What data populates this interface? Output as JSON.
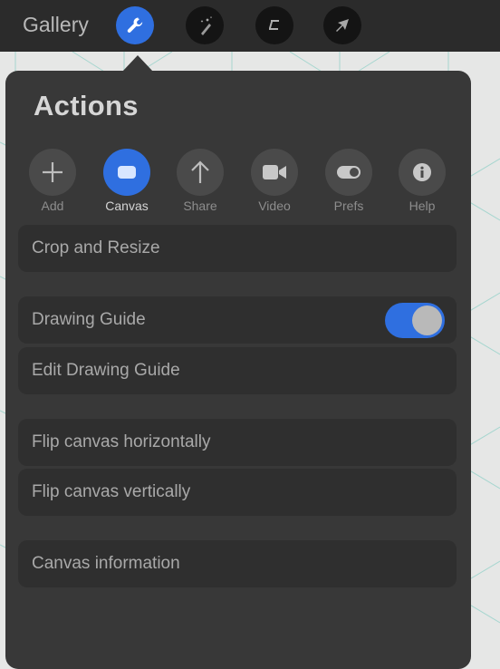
{
  "toolbar": {
    "gallery_label": "Gallery",
    "tools": [
      {
        "name": "actions",
        "icon": "wrench-icon",
        "active": true
      },
      {
        "name": "adjustments",
        "icon": "magic-wand-icon",
        "active": false
      },
      {
        "name": "selection",
        "icon": "selection-s-icon",
        "active": false
      },
      {
        "name": "transform",
        "icon": "arrow-cursor-icon",
        "active": false
      }
    ]
  },
  "panel": {
    "title": "Actions",
    "tabs": [
      {
        "label": "Add",
        "icon": "plus-icon",
        "active": false
      },
      {
        "label": "Canvas",
        "icon": "canvas-icon",
        "active": true
      },
      {
        "label": "Share",
        "icon": "share-arrow-icon",
        "active": false
      },
      {
        "label": "Video",
        "icon": "video-camera-icon",
        "active": false
      },
      {
        "label": "Prefs",
        "icon": "toggle-prefs-icon",
        "active": false
      },
      {
        "label": "Help",
        "icon": "info-icon",
        "active": false
      }
    ],
    "items": [
      {
        "label": "Crop and Resize"
      },
      {
        "label": "Drawing Guide",
        "toggle": true,
        "toggle_on": true
      },
      {
        "label": "Edit Drawing Guide"
      },
      {
        "label": "Flip canvas horizontally"
      },
      {
        "label": "Flip canvas vertically"
      },
      {
        "label": "Canvas information"
      }
    ]
  },
  "colors": {
    "accent": "#2f6fe0",
    "panel_bg": "#383838",
    "row_bg": "#2f2f2f",
    "toolbar_bg": "#2b2b2b",
    "guide_lines": "#9fd3cc"
  }
}
